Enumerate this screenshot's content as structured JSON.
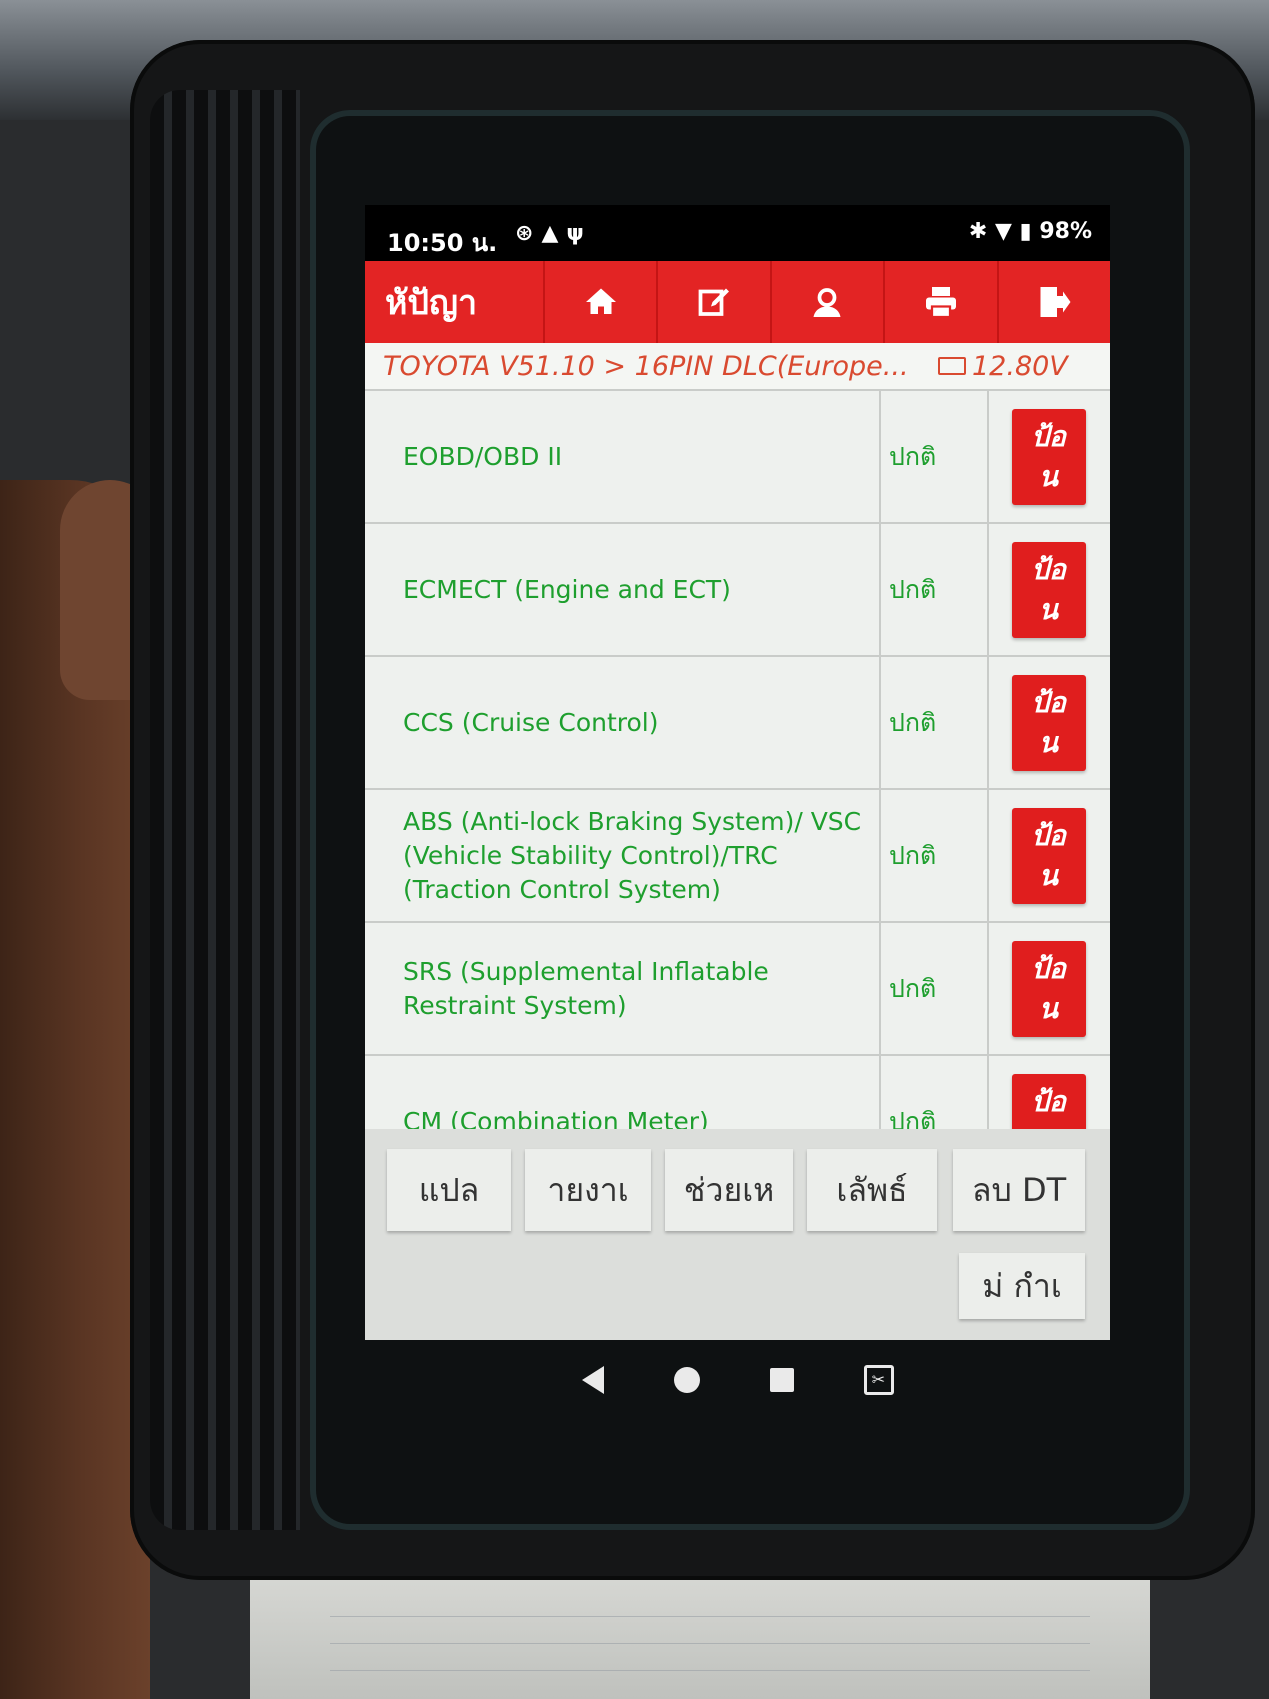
{
  "status_bar": {
    "time": "10:50 น.",
    "left_icons": [
      "whatsapp-icon",
      "warning-icon",
      "usb-icon"
    ],
    "battery": "98%",
    "right_icons": [
      "bluetooth-icon",
      "wifi-icon",
      "battery-icon"
    ]
  },
  "toolbar": {
    "title": "หัปัญา",
    "buttons": [
      "home-icon",
      "edit-icon",
      "user-icon",
      "print-icon",
      "exit-icon"
    ]
  },
  "breadcrumb": {
    "path": "TOYOTA V51.10 > 16PIN DLC(Europe...",
    "voltage": "12.80V"
  },
  "systems": [
    {
      "name": "EOBD/OBD II",
      "status": "ปกติ",
      "action": "ป้อ\nน"
    },
    {
      "name": "ECMECT (Engine and ECT)",
      "status": "ปกติ",
      "action": "ป้อ\nน"
    },
    {
      "name": "CCS (Cruise Control)",
      "status": "ปกติ",
      "action": "ป้อ\nน"
    },
    {
      "name": "ABS (Anti-lock Braking System)/ VSC (Vehicle Stability Control)/TRC (Traction Control System)",
      "status": "ปกติ",
      "action": "ป้อ\nน"
    },
    {
      "name": "SRS (Supplemental Inflatable Restraint System)",
      "status": "ปกติ",
      "action": "ป้อ\nน"
    },
    {
      "name": "CM (Combination Meter)",
      "status": "ปกติ",
      "action": "ป้อ\nน"
    }
  ],
  "footer_buttons": {
    "translate": "แปล",
    "report": "ายงาเ",
    "help": "ช่วยเห",
    "result": "เลัพธ์",
    "clear_dtc": "ลบ DT",
    "no_code": "ม่ กำเ"
  }
}
